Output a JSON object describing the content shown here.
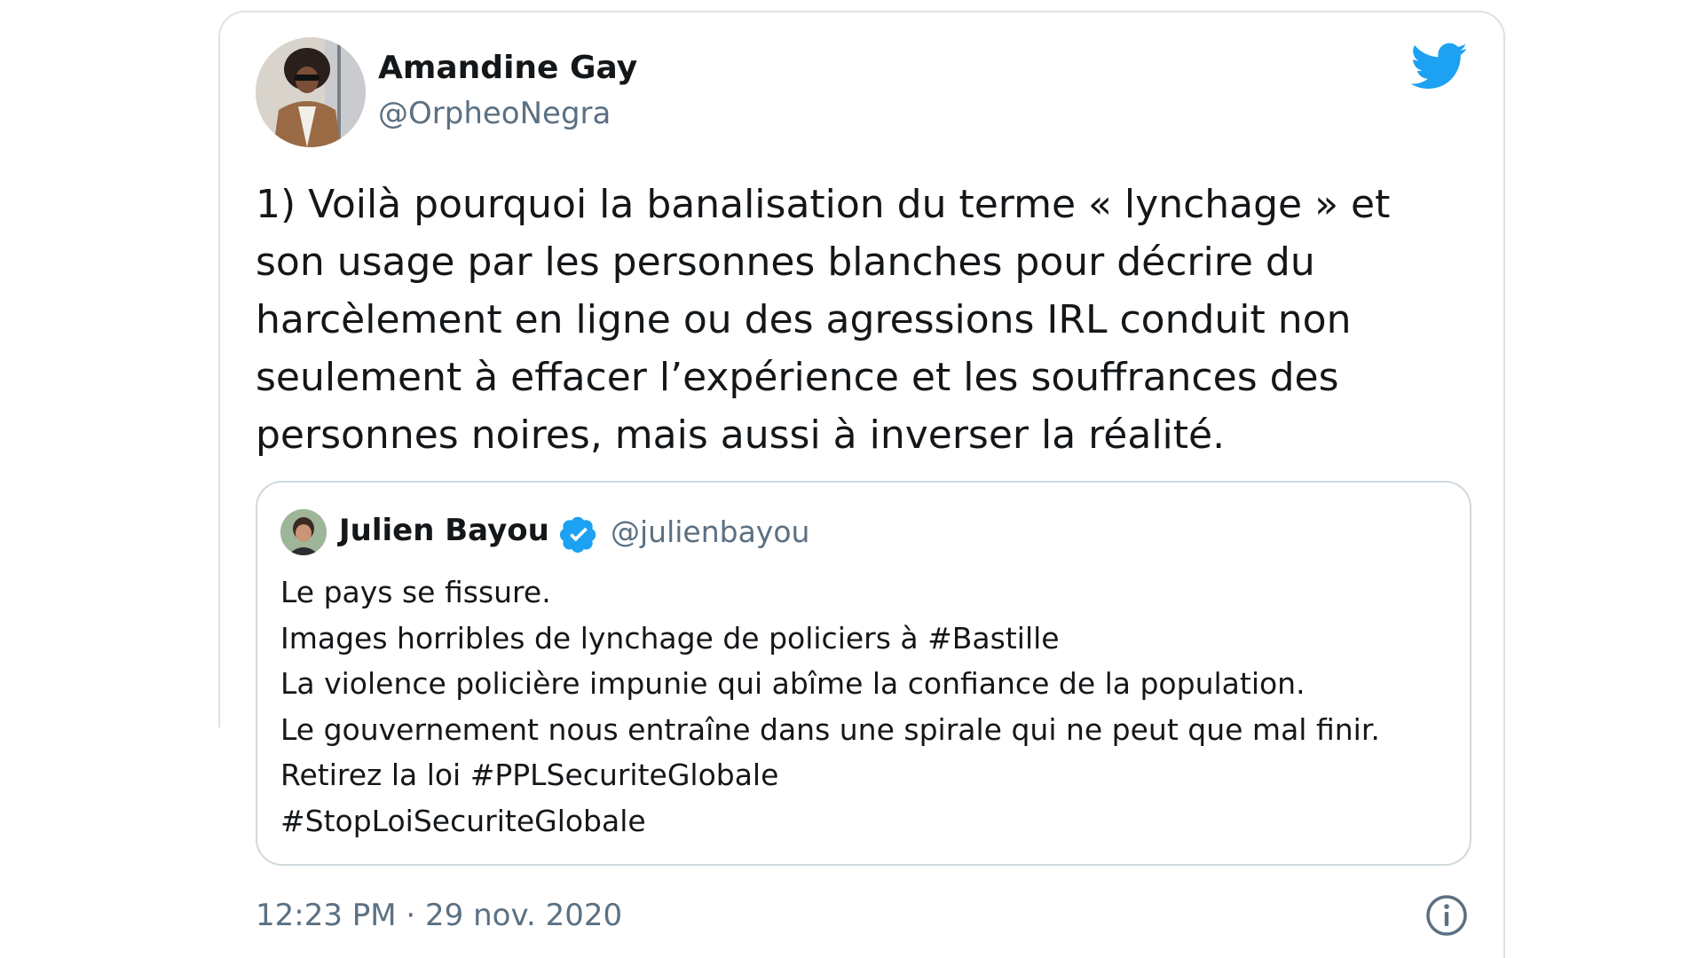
{
  "tweet": {
    "author_name": "Amandine Gay",
    "author_handle": "@OrpheoNegra",
    "text_lines": [
      "1) Voilà pourquoi la banalisation du terme « lynchage » et",
      "son usage par les personnes blanches pour décrire du",
      "harcèlement en ligne ou des agressions IRL conduit non",
      "seulement à effacer l’expérience et les souffrances des",
      "personnes noires, mais aussi à inverser la réalité."
    ],
    "timestamp": "12:23 PM · 29 nov. 2020",
    "icons": {
      "brand": "twitter-bird-icon",
      "info": "info-icon"
    },
    "colors": {
      "brand": "#1da1f2",
      "muted": "#5b7083",
      "text": "#14171a",
      "border": "#cfd9de"
    }
  },
  "quoted_tweet": {
    "author_name": "Julien Bayou",
    "author_handle": "@julienbayou",
    "verified": true,
    "text_lines": [
      "Le pays se fissure.",
      "Images horribles de lynchage de policiers à #Bastille",
      "La violence policière impunie qui abîme la confiance de la population.",
      "Le gouvernement nous entraîne dans une spirale qui ne peut que mal finir.",
      "Retirez la loi #PPLSecuriteGlobale",
      "#StopLoiSecuriteGlobale"
    ]
  }
}
